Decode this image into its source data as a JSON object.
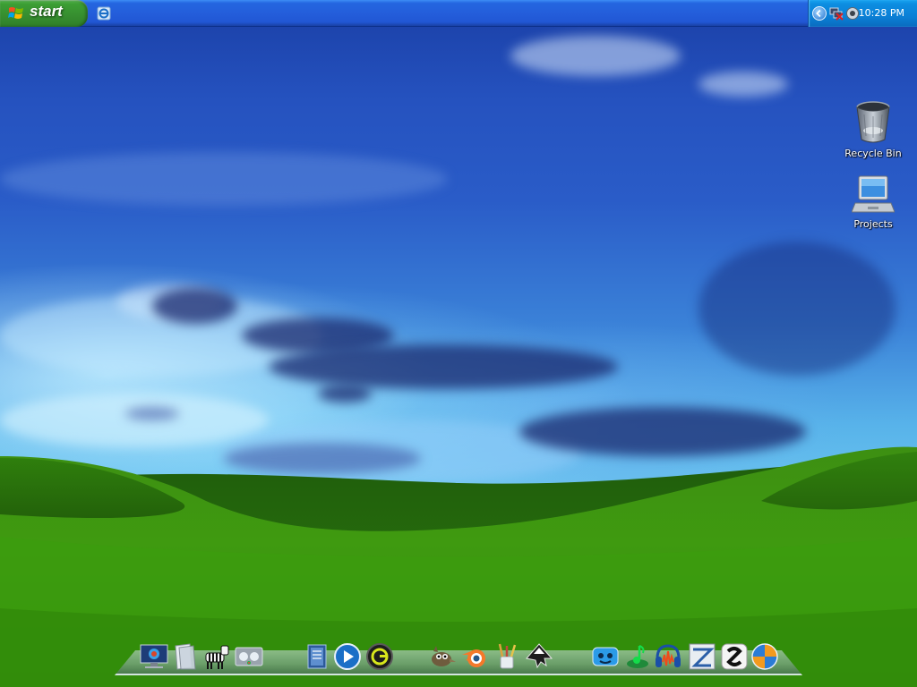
{
  "taskbar": {
    "start_label": "start",
    "clock": "10:28 PM",
    "quicklaunch_icon": "internet-explorer-icon",
    "tray_icons": [
      "show-hidden-icons-arrow-icon",
      "network-disconnected-icon",
      "volume-icon"
    ]
  },
  "desktop": {
    "icons": [
      {
        "label": "Recycle Bin",
        "icon": "recycle-bin-icon"
      },
      {
        "label": "Projects",
        "icon": "laptop-icon"
      }
    ]
  },
  "dock": {
    "items": [
      "desktop-monitor-icon",
      "paper-folder-icon",
      "zebra-icon",
      "media-player-icon",
      "notes-icon",
      "play-icon",
      "g-app-icon",
      "gimp-icon",
      "blender-icon",
      "paint-brushes-icon",
      "inkscape-icon",
      "chat-app-icon",
      "music-app-icon",
      "audacity-icon",
      "z-app-icon",
      "zip-app-icon",
      "globe-orange-icon"
    ]
  },
  "colors": {
    "taskbar_blue": "#245edb",
    "start_green": "#3c9e34",
    "tray_blue": "#0b80d6",
    "grass_green": "#3f9a10",
    "sky_blue": "#2a5cc8"
  }
}
